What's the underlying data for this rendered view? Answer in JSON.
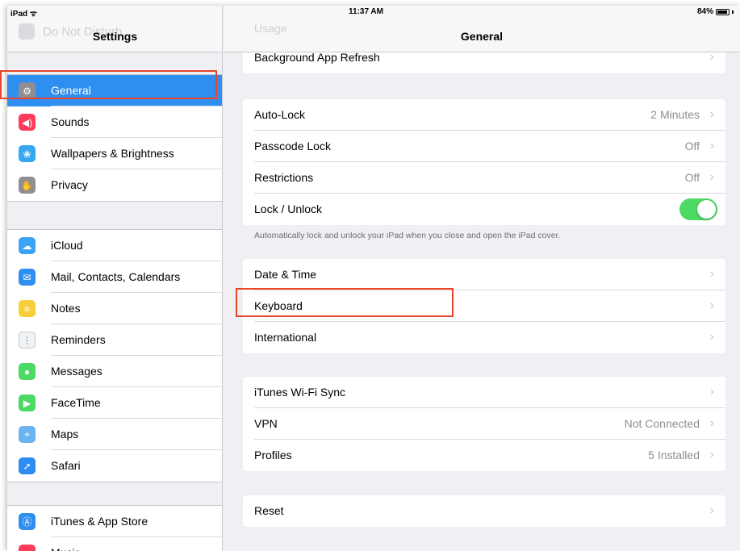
{
  "status_bar": {
    "device": "iPad",
    "wifi_symbol": "ᯤ",
    "time": "11:37 AM",
    "battery": "84%"
  },
  "sidebar": {
    "title": "Settings",
    "ghost_item": "Do Not Disturb",
    "groups": [
      [
        {
          "label": "General",
          "icon": "gear-icon",
          "color": "#8e8e93",
          "glyph": "⚙",
          "selected": true
        },
        {
          "label": "Sounds",
          "icon": "speaker-icon",
          "color": "#ff3b5c",
          "glyph": "◀)"
        },
        {
          "label": "Wallpapers & Brightness",
          "icon": "flower-icon",
          "color": "#35a9f0",
          "glyph": "❀"
        },
        {
          "label": "Privacy",
          "icon": "hand-icon",
          "color": "#8e8e93",
          "glyph": "✋"
        }
      ],
      [
        {
          "label": "iCloud",
          "icon": "cloud-icon",
          "color": "#3aa3f5",
          "glyph": "☁"
        },
        {
          "label": "Mail, Contacts, Calendars",
          "icon": "envelope-icon",
          "color": "#2f8ff0",
          "glyph": "✉"
        },
        {
          "label": "Notes",
          "icon": "notepad-icon",
          "color": "#f7cf3a",
          "glyph": "≡"
        },
        {
          "label": "Reminders",
          "icon": "list-icon",
          "color": "#f2f2f2",
          "glyph": "⋮"
        },
        {
          "label": "Messages",
          "icon": "speech-bubble-icon",
          "color": "#4cd964",
          "glyph": "●"
        },
        {
          "label": "FaceTime",
          "icon": "video-camera-icon",
          "color": "#4cd964",
          "glyph": "▶"
        },
        {
          "label": "Maps",
          "icon": "map-icon",
          "color": "#6cb4f0",
          "glyph": "⌖"
        },
        {
          "label": "Safari",
          "icon": "compass-icon",
          "color": "#2d8cf0",
          "glyph": "➚"
        }
      ],
      [
        {
          "label": "iTunes & App Store",
          "icon": "app-store-icon",
          "color": "#2f8ff0",
          "glyph": "Ⓐ"
        },
        {
          "label": "Music",
          "icon": "music-note-icon",
          "color": "#ff3b5c",
          "glyph": "♫"
        }
      ]
    ]
  },
  "detail": {
    "title": "General",
    "ghost_item": "Usage",
    "groups": [
      [
        {
          "label": "Background App Refresh",
          "value": "",
          "type": "nav"
        }
      ],
      [
        {
          "label": "Auto-Lock",
          "value": "2 Minutes",
          "type": "nav"
        },
        {
          "label": "Passcode Lock",
          "value": "Off",
          "type": "nav"
        },
        {
          "label": "Restrictions",
          "value": "Off",
          "type": "nav"
        },
        {
          "label": "Lock / Unlock",
          "value": "",
          "type": "toggle",
          "on": true
        }
      ],
      [
        {
          "label": "Date & Time",
          "value": "",
          "type": "nav"
        },
        {
          "label": "Keyboard",
          "value": "",
          "type": "nav"
        },
        {
          "label": "International",
          "value": "",
          "type": "nav"
        }
      ],
      [
        {
          "label": "iTunes Wi-Fi Sync",
          "value": "",
          "type": "nav"
        },
        {
          "label": "VPN",
          "value": "Not Connected",
          "type": "nav"
        },
        {
          "label": "Profiles",
          "value": "5 Installed",
          "type": "nav"
        }
      ],
      [
        {
          "label": "Reset",
          "value": "",
          "type": "nav"
        }
      ]
    ],
    "lock_footnote": "Automatically lock and unlock your iPad when you close and open the iPad cover.",
    "chevron": "›"
  },
  "colors": {
    "accent": "#2f8ff0",
    "highlight": "#e8462a",
    "toggle_on": "#4cd964"
  }
}
